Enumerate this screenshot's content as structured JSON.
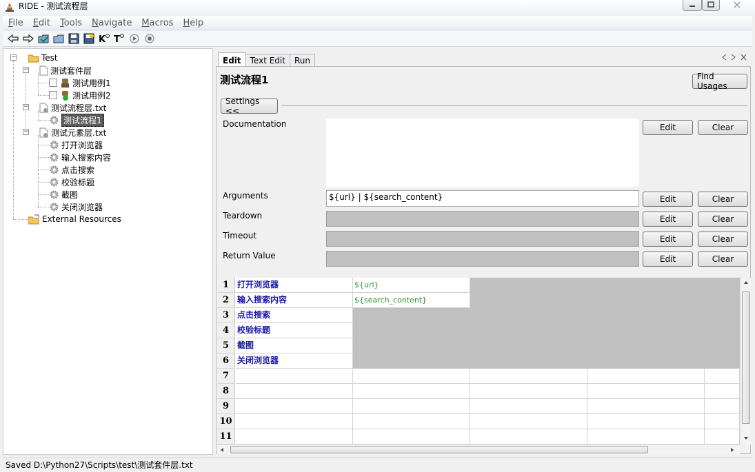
{
  "window": {
    "title": "RIDE - 测试流程层"
  },
  "menu": [
    "File",
    "Edit",
    "Tools",
    "Navigate",
    "Macros",
    "Help"
  ],
  "toolbar": [
    "back-icon",
    "forward-icon",
    "open-test-suite-icon",
    "open-directory-icon",
    "save-icon",
    "save-all-icon",
    "search-keywords-icon",
    "search-tests-icon",
    "run-icon",
    "stop-icon"
  ],
  "tree": {
    "root": "Test",
    "suite": "测试套件层",
    "suite_cases": [
      "测试用例1",
      "测试用例2"
    ],
    "flow_file": "测试流程层.txt",
    "flow_keyword": "测试流程1",
    "element_file": "测试元素层.txt",
    "element_keywords": [
      "打开浏览器",
      "输入搜索内容",
      "点击搜索",
      "校验标题",
      "截图",
      "关闭浏览器"
    ],
    "external": "External Resources"
  },
  "tabs": [
    "Edit",
    "Text Edit",
    "Run"
  ],
  "editor": {
    "title": "测试流程1",
    "find_usages": "Find Usages",
    "settings_toggle": "Settings <<",
    "edit_label": "Edit",
    "clear_label": "Clear",
    "fields": {
      "documentation": {
        "label": "Documentation",
        "value": ""
      },
      "arguments": {
        "label": "Arguments",
        "value": "${url} | ${search_content}"
      },
      "teardown": {
        "label": "Teardown",
        "value": ""
      },
      "timeout": {
        "label": "Timeout",
        "value": ""
      },
      "return_value": {
        "label": "Return Value",
        "value": ""
      }
    }
  },
  "grid": {
    "rows": [
      {
        "num": "1",
        "keyword": "打开浏览器",
        "arg": "${url}"
      },
      {
        "num": "2",
        "keyword": "输入搜索内容",
        "arg": "${search_content}"
      },
      {
        "num": "3",
        "keyword": "点击搜索",
        "arg": ""
      },
      {
        "num": "4",
        "keyword": "校验标题",
        "arg": ""
      },
      {
        "num": "5",
        "keyword": "截图",
        "arg": ""
      },
      {
        "num": "6",
        "keyword": "关闭浏览器",
        "arg": ""
      },
      {
        "num": "7",
        "keyword": "",
        "arg": ""
      },
      {
        "num": "8",
        "keyword": "",
        "arg": ""
      },
      {
        "num": "9",
        "keyword": "",
        "arg": ""
      },
      {
        "num": "10",
        "keyword": "",
        "arg": ""
      },
      {
        "num": "11",
        "keyword": "",
        "arg": ""
      }
    ]
  },
  "status": "Saved D:\\Python27\\Scripts\\test\\测试套件层.txt"
}
